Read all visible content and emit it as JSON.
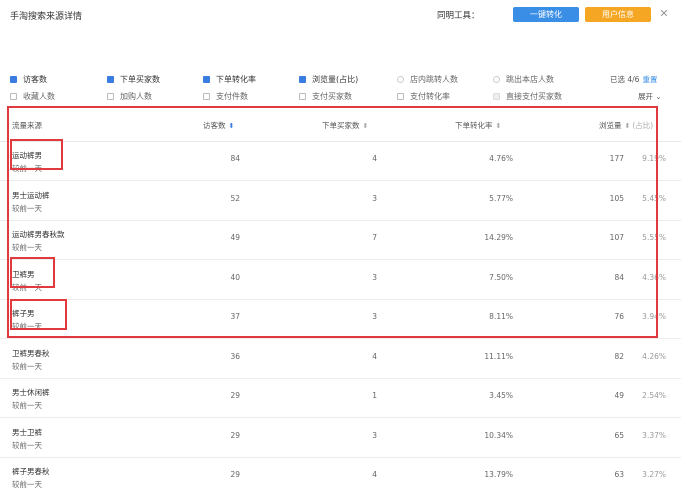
{
  "header": {
    "title": "手淘搜索来源详情",
    "tool_label": "同明工具：",
    "convert_button": "一键转化",
    "user_button": "用户信息",
    "close_icon": "close-icon"
  },
  "metrics": {
    "row1": [
      {
        "label": "访客数",
        "state": "checked"
      },
      {
        "label": "下单买家数",
        "state": "checked"
      },
      {
        "label": "下单转化率",
        "state": "checked"
      },
      {
        "label": "浏览量(占比)",
        "state": "checked"
      },
      {
        "label": "店内跳转人数",
        "state": "radio"
      },
      {
        "label": "跳出本店人数",
        "state": "radio"
      }
    ],
    "row2": [
      {
        "label": "收藏人数",
        "state": "unchecked"
      },
      {
        "label": "加购人数",
        "state": "unchecked"
      },
      {
        "label": "支付件数",
        "state": "unchecked"
      },
      {
        "label": "支付买家数",
        "state": "unchecked"
      },
      {
        "label": "支付转化率",
        "state": "unchecked"
      },
      {
        "label": "直接支付买家数",
        "state": "disabled"
      }
    ],
    "selected_text": "已选 4/6",
    "reset_label": "重置",
    "expand_label": "展开",
    "expand_icon": "chevron-down-icon"
  },
  "table": {
    "headers": {
      "source": "流量来源",
      "visitors": "访客数",
      "buyers": "下单买家数",
      "rate": "下单转化率",
      "pv": "浏览量",
      "share": "(占比)"
    },
    "compare_label": "较前一天",
    "rows": [
      {
        "source": "运动裤男",
        "visitors": "84",
        "buyers": "4",
        "rate": "4.76%",
        "pv": "177",
        "share": "9.19%"
      },
      {
        "source": "男士运动裤",
        "visitors": "52",
        "buyers": "3",
        "rate": "5.77%",
        "pv": "105",
        "share": "5.45%"
      },
      {
        "source": "运动裤男春秋款",
        "visitors": "49",
        "buyers": "7",
        "rate": "14.29%",
        "pv": "107",
        "share": "5.55%"
      },
      {
        "source": "卫裤男",
        "visitors": "40",
        "buyers": "3",
        "rate": "7.50%",
        "pv": "84",
        "share": "4.36%"
      },
      {
        "source": "裤子男",
        "visitors": "37",
        "buyers": "3",
        "rate": "8.11%",
        "pv": "76",
        "share": "3.94%"
      },
      {
        "source": "卫裤男春秋",
        "visitors": "36",
        "buyers": "4",
        "rate": "11.11%",
        "pv": "82",
        "share": "4.26%"
      },
      {
        "source": "男士休闲裤",
        "visitors": "29",
        "buyers": "1",
        "rate": "3.45%",
        "pv": "49",
        "share": "2.54%"
      },
      {
        "source": "男士卫裤",
        "visitors": "29",
        "buyers": "3",
        "rate": "10.34%",
        "pv": "65",
        "share": "3.37%"
      },
      {
        "source": "裤子男春秋",
        "visitors": "29",
        "buyers": "4",
        "rate": "13.79%",
        "pv": "63",
        "share": "3.27%"
      }
    ]
  },
  "colors": {
    "accent": "#3a8ee6",
    "orange": "#f5a623",
    "highlight": "#e0393e"
  }
}
